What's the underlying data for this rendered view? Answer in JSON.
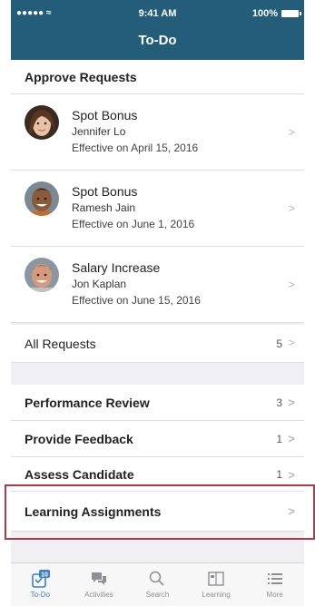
{
  "status_bar": {
    "signal": "●●●●● ",
    "time": "9:41 AM",
    "battery": "100%"
  },
  "header": {
    "title": "To-Do"
  },
  "approve_section": {
    "title": "Approve Requests",
    "requests": [
      {
        "type": "Spot Bonus",
        "person": "Jennifer Lo",
        "effective": "Effective on April 15, 2016"
      },
      {
        "type": "Spot Bonus",
        "person": "Ramesh Jain",
        "effective": "Effective on June 1, 2016"
      },
      {
        "type": "Salary Increase",
        "person": "Jon Kaplan",
        "effective": "Effective on June 15, 2016"
      }
    ],
    "all_requests": {
      "label": "All Requests",
      "count": "5"
    }
  },
  "tasks": [
    {
      "label": "Performance Review",
      "count": "3"
    },
    {
      "label": "Provide Feedback",
      "count": "1"
    },
    {
      "label": "Assess Candidate",
      "count": "1"
    },
    {
      "label": "Learning Assignments",
      "count": ""
    }
  ],
  "tabbar": {
    "tabs": [
      {
        "label": "To-Do",
        "icon": "todo-icon",
        "badge": "10"
      },
      {
        "label": "Activities",
        "icon": "activities-icon"
      },
      {
        "label": "Search",
        "icon": "search-icon"
      },
      {
        "label": "Learning",
        "icon": "learning-icon"
      },
      {
        "label": "More",
        "icon": "more-icon"
      }
    ]
  },
  "colors": {
    "header_bg": "#245d7a",
    "accent": "#3f7fc4",
    "highlight": "#b03a45"
  }
}
